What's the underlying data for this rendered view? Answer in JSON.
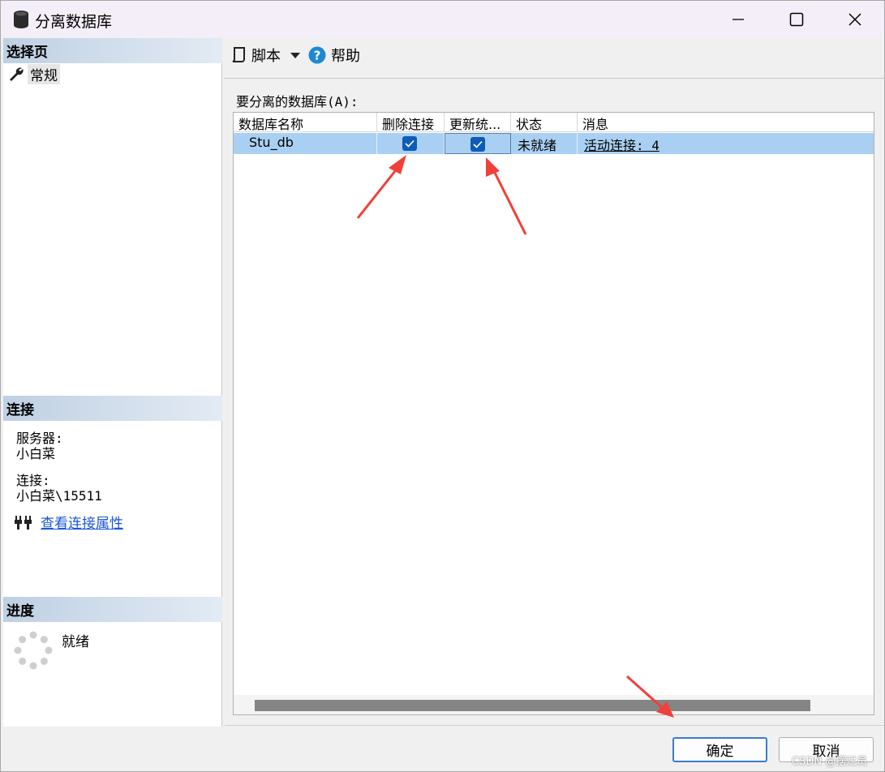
{
  "window": {
    "title": "分离数据库",
    "icon": "database-icon"
  },
  "left": {
    "select_page_header": "选择页",
    "nav_items": [
      {
        "label": "常规",
        "icon": "wrench-icon"
      }
    ],
    "connection_header": "连接",
    "server_label": "服务器:",
    "server_value": "小白菜",
    "connection_label": "连接:",
    "connection_value": "小白菜\\15511",
    "view_connection_props": "查看连接属性",
    "progress_header": "进度",
    "progress_status": "就绪"
  },
  "toolbar": {
    "script_label": "脚本",
    "help_label": "帮助"
  },
  "grid": {
    "label": "要分离的数据库(A):",
    "columns": [
      "数据库名称",
      "删除连接",
      "更新统...",
      "状态",
      "消息"
    ],
    "rows": [
      {
        "name": "Stu_db",
        "drop_connections": true,
        "update_statistics": true,
        "status": "未就绪",
        "message": "活动连接: 4"
      }
    ]
  },
  "buttons": {
    "ok": "确定",
    "cancel": "取消"
  },
  "watermark": "CSDN @摆烂员",
  "colors": {
    "selected_row": "#a9d0f2",
    "checkbox": "#0f5bb8",
    "annotation_arrow": "#f0403a",
    "link": "#1a55d6"
  }
}
